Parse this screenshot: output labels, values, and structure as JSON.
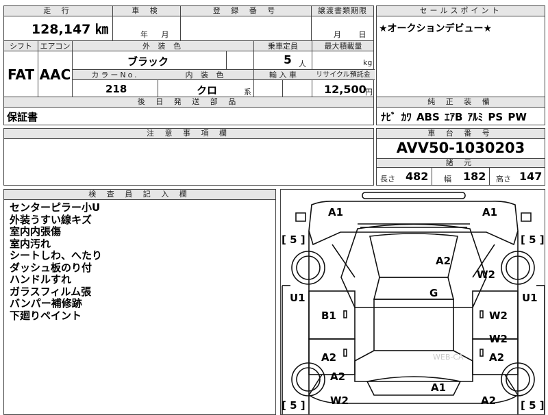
{
  "header": {
    "mileage_label": "走 行",
    "mileage_value": "128,147 ㎞",
    "inspection_label": "車 検",
    "inspection_value": "年 月",
    "registration_label": "登 録 番 号",
    "transfer_deadline_label": "譲渡書類期限",
    "transfer_deadline_value": "月 日",
    "sales_point_label": "セールスポイント",
    "sales_point_text": "★オークションデビュー★"
  },
  "specs": {
    "shift_label": "シフト",
    "shift_value": "FAT",
    "ac_label": "エアコン",
    "ac_value": "AAC",
    "exterior_color_label": "外 装 色",
    "exterior_color_value": "ブラック",
    "capacity_label": "乗車定員",
    "capacity_value": "5",
    "capacity_unit": "人",
    "max_load_label": "最大積載量",
    "max_load_unit": "kg",
    "color_no_label": "カラーNo.",
    "color_no_value": "218",
    "interior_color_label": "内 装 色",
    "interior_color_value": "クロ",
    "interior_color_suffix": "系",
    "import_label": "輸 入 車",
    "recycle_label": "リサイクル預託金",
    "recycle_value": "12,500",
    "recycle_unit": "円"
  },
  "parts": {
    "label": "後 日 発 送 部 品",
    "value": "保証書"
  },
  "equipment": {
    "label": "純 正 装 備",
    "value": "ﾅﾋﾞ ｶﾜ ABS ｴｱB ｱﾙﾐ PS PW"
  },
  "caution": {
    "label": "注 意 事 項 欄"
  },
  "chassis": {
    "label": "車 台 番 号",
    "value": "AVV50-1030203",
    "specs_label": "諸 元",
    "length_label": "長さ",
    "length_value": "482",
    "width_label": "幅",
    "width_value": "182",
    "height_label": "高さ",
    "height_value": "147"
  },
  "inspector": {
    "label": "検 査 員 記 入 欄",
    "notes": [
      "センターピラー小U",
      "外装うすい線キズ",
      "室内内張傷",
      "室内汚れ",
      "シートしわ、へたり",
      "ダッシュ板のり付",
      "ハンドルすれ",
      "ガラスフィルム張",
      "バンパー補修跡",
      "下廻りペイント"
    ]
  },
  "diagram": {
    "marks": [
      "A1",
      "A1",
      "[ 5 ]",
      "[ 5 ]",
      "A2",
      "W2",
      "U1",
      "G",
      "U1",
      "B1",
      "W2",
      "W2",
      "A2",
      "A2",
      "A2",
      "A1",
      "W2",
      "A2",
      "[ 5 ]",
      "[ 5 ]"
    ],
    "watermark": "WEB-CA"
  }
}
